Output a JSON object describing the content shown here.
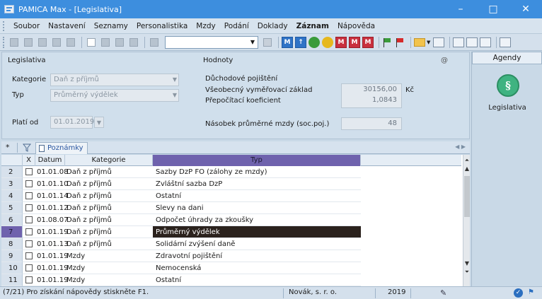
{
  "window": {
    "title": "PAMICA Max - [Legislativa]",
    "buttons": [
      "–",
      "□",
      "✕"
    ]
  },
  "menu": [
    {
      "label": "Soubor"
    },
    {
      "label": "Nastavení"
    },
    {
      "label": "Seznamy"
    },
    {
      "label": "Personalistika"
    },
    {
      "label": "Mzdy"
    },
    {
      "label": "Podání"
    },
    {
      "label": "Doklady"
    },
    {
      "label": "Záznam"
    },
    {
      "label": "Nápověda"
    }
  ],
  "toolbar": {
    "letters": [
      "M",
      "M",
      "M",
      "M"
    ]
  },
  "form": {
    "section_left": "Legislativa",
    "section_right": "Hodnoty",
    "at_symbol": "@",
    "kategorie_label": "Kategorie",
    "kategorie_value": "Daň z příjmů",
    "typ_label": "Typ",
    "typ_value": "Průměrný výdělek",
    "plati_od_label": "Platí od",
    "plati_od_value": "01.01.2019",
    "duchodove": "Důchodové pojištění",
    "vseobecny_label": "Všeobecný vyměřovací základ",
    "vseobecny_value": "30156,00",
    "vseobecny_unit": "Kč",
    "prepocitaci_label": "Přepočítací koeficient",
    "prepocitaci_value": "1,0843",
    "nasobek_label": "Násobek průměrné mzdy (soc.poj.)",
    "nasobek_value": "48"
  },
  "agenda": {
    "header": "Agendy",
    "item": "Legislativa",
    "symbol": "§"
  },
  "tabs": {
    "star": "*",
    "poznamky": "Poznámky"
  },
  "grid": {
    "headers": {
      "x": "X",
      "datum": "Datum",
      "kategorie": "Kategorie",
      "typ": "Typ"
    },
    "rows": [
      {
        "n": "2",
        "datum": "01.01.08",
        "kategorie": "Daň z příjmů",
        "typ": "Sazby DzP FO (zálohy ze mzdy)"
      },
      {
        "n": "3",
        "datum": "01.01.10",
        "kategorie": "Daň z příjmů",
        "typ": "Zvláštní sazba DzP"
      },
      {
        "n": "4",
        "datum": "01.01.14",
        "kategorie": "Daň z příjmů",
        "typ": "Ostatní"
      },
      {
        "n": "5",
        "datum": "01.01.12",
        "kategorie": "Daň z příjmů",
        "typ": "Slevy na dani"
      },
      {
        "n": "6",
        "datum": "01.08.07",
        "kategorie": "Daň z příjmů",
        "typ": "Odpočet úhrady za zkoušky"
      },
      {
        "n": "7",
        "datum": "01.01.19",
        "kategorie": "Daň z příjmů",
        "typ": "Průměrný výdělek",
        "selected": true
      },
      {
        "n": "8",
        "datum": "01.01.13",
        "kategorie": "Daň z příjmů",
        "typ": "Solidární zvýšení daně"
      },
      {
        "n": "9",
        "datum": "01.01.19",
        "kategorie": "Mzdy",
        "typ": "Zdravotní pojištění"
      },
      {
        "n": "10",
        "datum": "01.01.19",
        "kategorie": "Mzdy",
        "typ": "Nemocenská"
      },
      {
        "n": "11",
        "datum": "01.01.19",
        "kategorie": "Mzdy",
        "typ": "Ostatní"
      }
    ]
  },
  "status": {
    "help": "(7/21) Pro získání nápovědy stiskněte F1.",
    "company": "Novák, s. r. o.",
    "year": "2019"
  }
}
